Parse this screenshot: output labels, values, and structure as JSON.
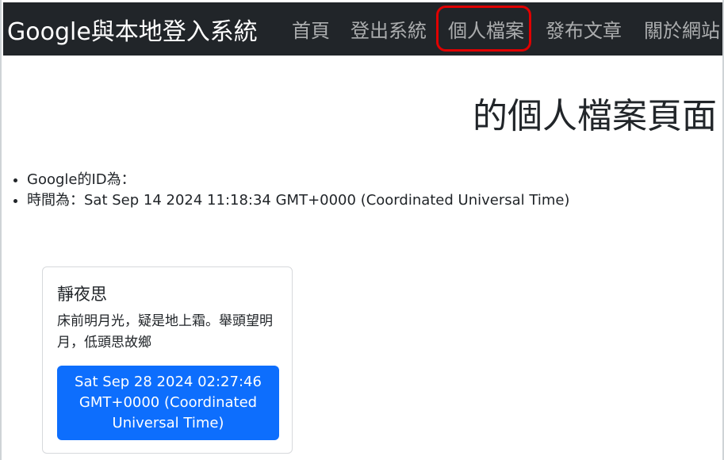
{
  "navbar": {
    "brand": "Google與本地登入系統",
    "links": {
      "home": "首頁",
      "logout": "登出系統",
      "profile": "個人檔案",
      "post": "發布文章",
      "about": "關於網站"
    },
    "highlight_color": "#e00000",
    "background": "#212529"
  },
  "page": {
    "title": "的個人檔案頁面"
  },
  "info": {
    "google_id": "Google的ID為：",
    "time": "時間為：Sat Sep 14 2024 11:18:34 GMT+0000 (Coordinated Universal Time)"
  },
  "post_card": {
    "title": "靜夜思",
    "content": "床前明月光，疑是地上霜。舉頭望明月，低頭思故鄉",
    "date_button": "Sat Sep 28 2024 02:27:46 GMT+0000 (Coordinated Universal Time)",
    "button_color": "#0d6efd"
  }
}
